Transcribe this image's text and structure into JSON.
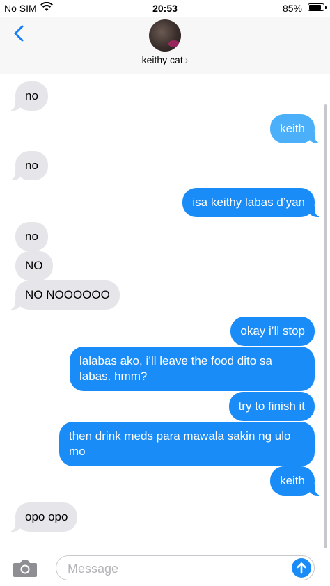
{
  "status_bar": {
    "carrier": "No SIM",
    "time": "20:53",
    "battery_percent_label": "85%",
    "battery_level": 0.85
  },
  "header": {
    "contact_name": "keithy cat",
    "chevron": "›",
    "back_icon": "chevron-left-icon"
  },
  "messages": [
    {
      "side": "in",
      "text": "no"
    },
    {
      "side": "out",
      "text": "keith"
    },
    {
      "side": "in",
      "text": "no"
    },
    {
      "side": "out",
      "text": "isa keithy labas d’yan"
    },
    {
      "side": "in",
      "text": "no"
    },
    {
      "side": "in",
      "text": "NO"
    },
    {
      "side": "in",
      "text": "NO NOOOOOO"
    },
    {
      "side": "out",
      "text": "okay i’ll stop"
    },
    {
      "side": "out",
      "text": "lalabas ako, i’ll leave the food dito sa labas. hmm?"
    },
    {
      "side": "out",
      "text": "try to finish it"
    },
    {
      "side": "out",
      "text": "then drink meds para mawala sakin ng ulo mo"
    },
    {
      "side": "out",
      "text": "keith"
    },
    {
      "side": "in",
      "text": "opo opo"
    }
  ],
  "input_bar": {
    "placeholder": "Message",
    "value": ""
  },
  "colors": {
    "outgoing": "#1a8cf7",
    "outgoing_faded": "#4bb0f9",
    "incoming": "#e5e5ea",
    "accent": "#147efb"
  }
}
